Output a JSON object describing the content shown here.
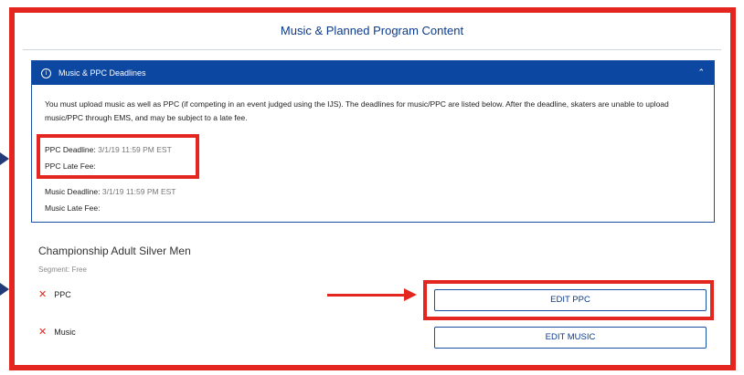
{
  "page": {
    "title": "Music & Planned Program Content"
  },
  "panel": {
    "header_title": "Music & PPC Deadlines",
    "info_icon": "i",
    "collapse_icon": "chevron-up-icon",
    "description": "You must upload music as well as PPC (if competing in an event judged using the IJS). The deadlines for music/PPC are listed below. After the deadline, skaters are unable to upload music/PPC through EMS, and may be subject to a late fee.",
    "ppc_deadline_label": "PPC Deadline:",
    "ppc_deadline_value": "3/1/19 11:59 PM EST",
    "ppc_late_fee_label": "PPC Late Fee:",
    "music_deadline_label": "Music Deadline:",
    "music_deadline_value": "3/1/19 11:59 PM EST",
    "music_late_fee_label": "Music Late Fee:"
  },
  "event": {
    "category": "Championship Adult Silver Men",
    "segment": "Segment: Free",
    "requirements": [
      {
        "label": "PPC",
        "status_icon": "x-icon",
        "button": "EDIT PPC"
      },
      {
        "label": "Music",
        "status_icon": "x-icon",
        "button": "EDIT MUSIC"
      }
    ]
  },
  "colors": {
    "annotation_red": "#e3261f",
    "header_blue": "#0c47a1",
    "title_blue": "#0b3a8c"
  }
}
